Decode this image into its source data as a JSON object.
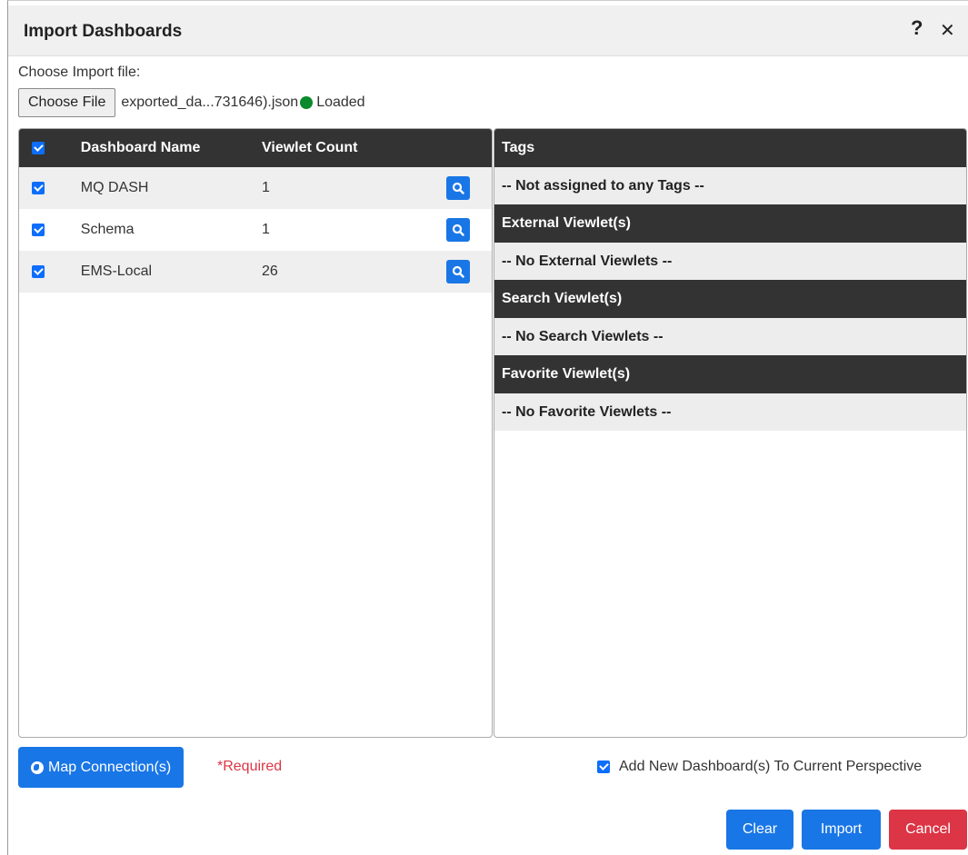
{
  "dialog": {
    "title": "Import Dashboards",
    "help_icon": "?",
    "close_icon": "✕"
  },
  "file": {
    "label": "Choose Import file:",
    "button_label": "Choose File",
    "filename": "exported_da...731646).json",
    "status": "Loaded",
    "status_color": "#0a8a2a"
  },
  "dashboards": {
    "headers": {
      "name": "Dashboard Name",
      "count": "Viewlet Count"
    },
    "rows": [
      {
        "name": "MQ DASH",
        "count": "1",
        "checked": true
      },
      {
        "name": "Schema",
        "count": "1",
        "checked": true
      },
      {
        "name": "EMS-Local",
        "count": "26",
        "checked": true
      }
    ]
  },
  "details": {
    "sections": [
      {
        "header": "Tags",
        "value": "-- Not assigned to any Tags --"
      },
      {
        "header": "External Viewlet(s)",
        "value": "-- No External Viewlets --"
      },
      {
        "header": "Search Viewlet(s)",
        "value": "-- No Search Viewlets --"
      },
      {
        "header": "Favorite Viewlet(s)",
        "value": "-- No Favorite Viewlets --"
      }
    ]
  },
  "footer": {
    "map_button": "Map Connection(s)",
    "required": "*Required",
    "add_perspective": "Add New Dashboard(s) To Current Perspective",
    "clear": "Clear",
    "import": "Import",
    "cancel": "Cancel"
  },
  "colors": {
    "primary": "#1976e6",
    "danger": "#dc3545",
    "header_bg": "#333333",
    "row_shade": "#efefef"
  }
}
